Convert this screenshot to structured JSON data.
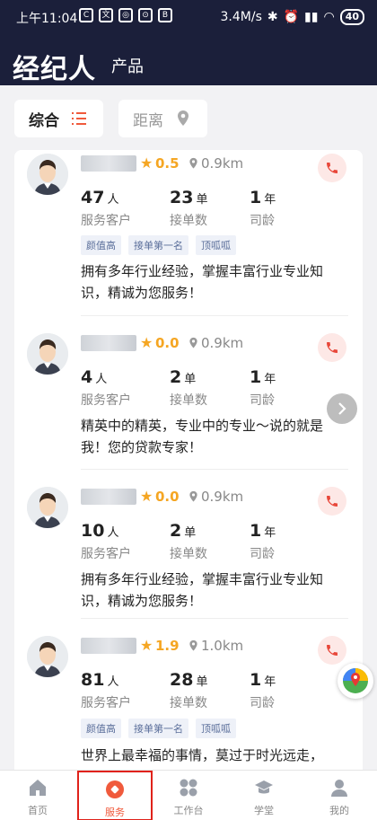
{
  "status_bar": {
    "time": "上午11:04",
    "speed": "3.4M/s",
    "battery": "40"
  },
  "header": {
    "title": "经纪人",
    "subtitle": "产品"
  },
  "filters": [
    {
      "label": "综合"
    },
    {
      "label": "距离"
    }
  ],
  "agents": [
    {
      "rating": "0.5",
      "distance": "0.9km",
      "clients": "47",
      "clients_unit": "人",
      "clients_label": "服务客户",
      "orders": "23",
      "orders_unit": "单",
      "orders_label": "接单数",
      "years": "1",
      "years_unit": "年",
      "years_label": "司龄",
      "tags": [
        "颜值高",
        "接单第一名",
        "顶呱呱"
      ],
      "desc": "拥有多年行业经验，掌握丰富行业专业知识，精诚为您服务！"
    },
    {
      "rating": "0.0",
      "distance": "0.9km",
      "clients": "4",
      "clients_unit": "人",
      "clients_label": "服务客户",
      "orders": "2",
      "orders_unit": "单",
      "orders_label": "接单数",
      "years": "1",
      "years_unit": "年",
      "years_label": "司龄",
      "tags": [],
      "desc": "精英中的精英，专业中的专业～说的就是我！您的贷款专家！"
    },
    {
      "rating": "0.0",
      "distance": "0.9km",
      "clients": "10",
      "clients_unit": "人",
      "clients_label": "服务客户",
      "orders": "2",
      "orders_unit": "单",
      "orders_label": "接单数",
      "years": "1",
      "years_unit": "年",
      "years_label": "司龄",
      "tags": [],
      "desc": "拥有多年行业经验，掌握丰富行业专业知识，精诚为您服务！"
    },
    {
      "rating": "1.9",
      "distance": "1.0km",
      "clients": "81",
      "clients_unit": "人",
      "clients_label": "服务客户",
      "orders": "28",
      "orders_unit": "单",
      "orders_label": "接单数",
      "years": "1",
      "years_unit": "年",
      "years_label": "司龄",
      "tags": [
        "颜值高",
        "接单第一名",
        "顶呱呱"
      ],
      "desc": "世界上最幸福的事情，莫过于时光远走，"
    }
  ],
  "tabbar": [
    {
      "label": "首页",
      "icon": "home-icon"
    },
    {
      "label": "服务",
      "icon": "service-icon",
      "active": true
    },
    {
      "label": "工作台",
      "icon": "workbench-icon"
    },
    {
      "label": "学堂",
      "icon": "school-icon"
    },
    {
      "label": "我的",
      "icon": "profile-icon"
    }
  ],
  "colors": {
    "header_bg": "#1b1f3a",
    "accent": "#f05a3c",
    "star": "#f5a623"
  }
}
